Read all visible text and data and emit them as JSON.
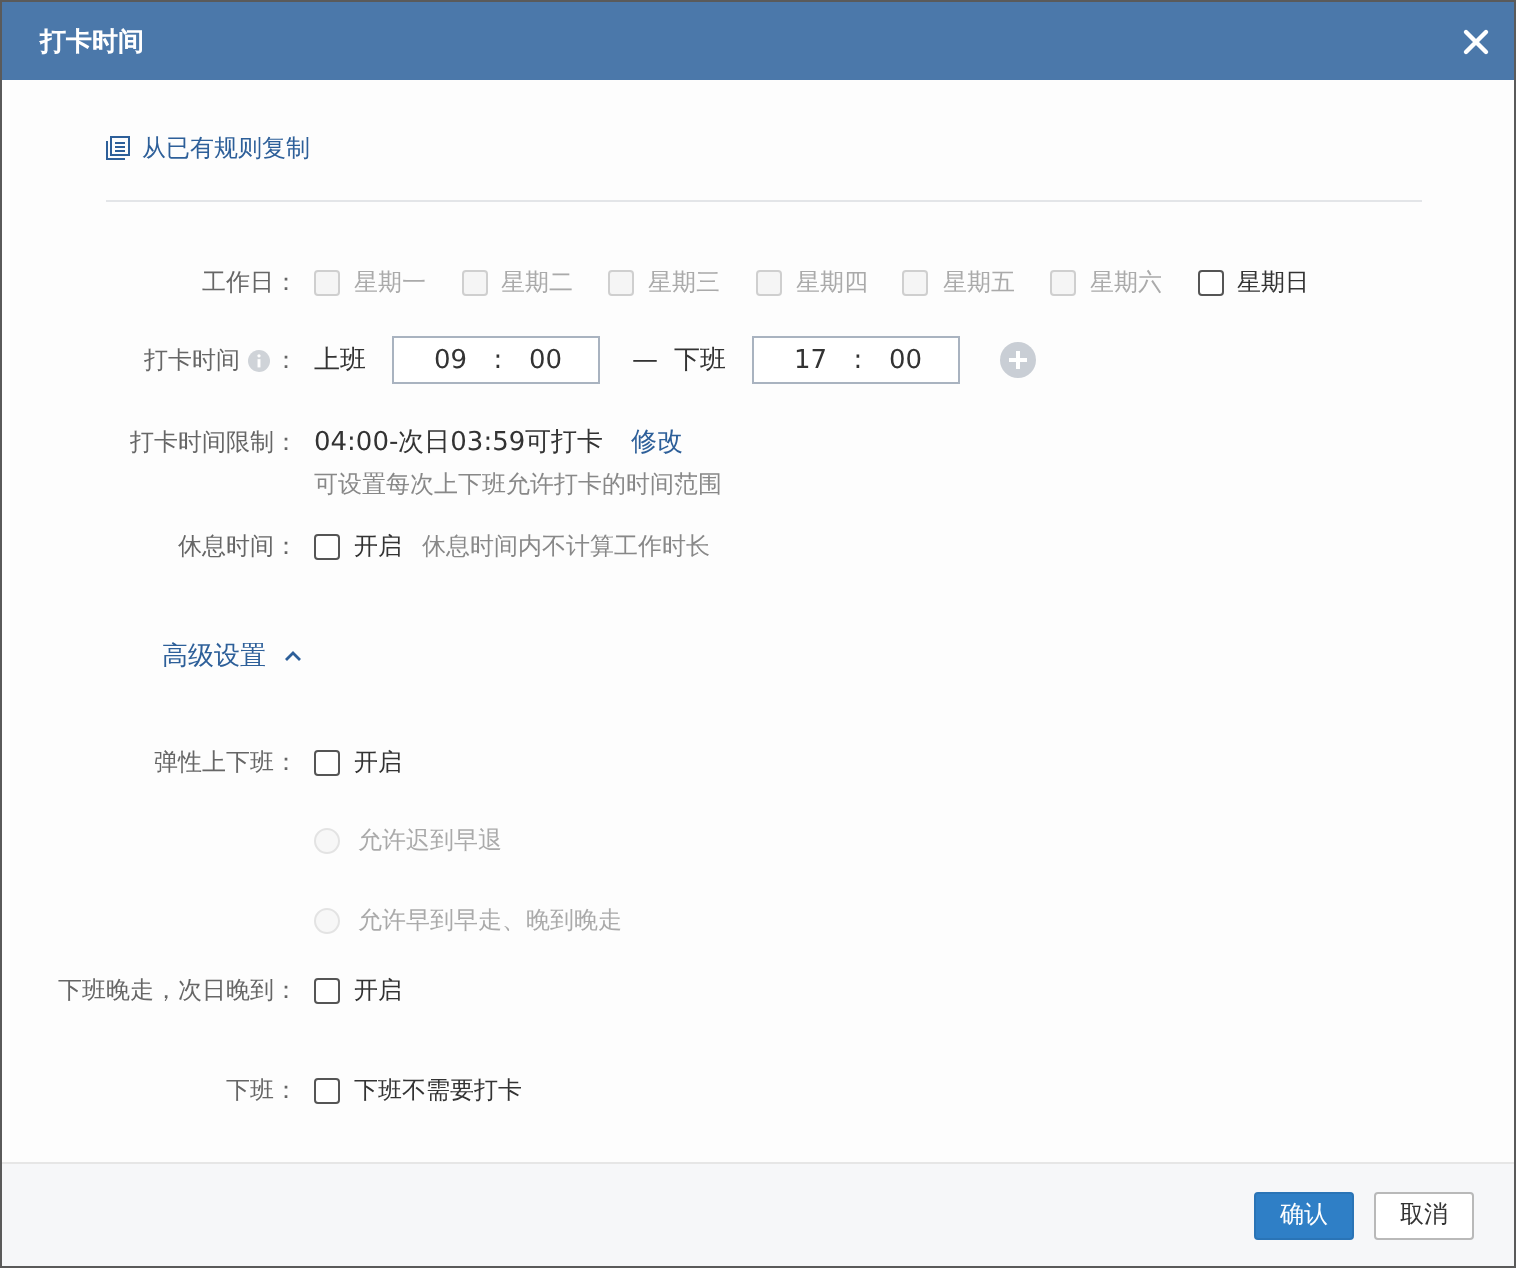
{
  "dialog": {
    "title": "打卡时间"
  },
  "copy_link": "从已有规则复制",
  "workdays": {
    "label": "工作日：",
    "days": [
      {
        "label": "星期一",
        "checked": false,
        "disabled": true
      },
      {
        "label": "星期二",
        "checked": false,
        "disabled": true
      },
      {
        "label": "星期三",
        "checked": false,
        "disabled": true
      },
      {
        "label": "星期四",
        "checked": false,
        "disabled": true
      },
      {
        "label": "星期五",
        "checked": false,
        "disabled": true
      },
      {
        "label": "星期六",
        "checked": false,
        "disabled": true
      },
      {
        "label": "星期日",
        "checked": false,
        "disabled": false
      }
    ]
  },
  "clock_time": {
    "label": "打卡时间",
    "colon": "：",
    "dash": "—",
    "shifts": [
      {
        "label": "上班",
        "hour": "09",
        "separator": ":",
        "minute": "00"
      },
      {
        "label": "下班",
        "hour": "17",
        "separator": ":",
        "minute": "00"
      }
    ]
  },
  "limit": {
    "label": "打卡时间限制：",
    "value": "04:00-次日03:59可打卡",
    "edit_link": "修改",
    "hint": "可设置每次上下班允许打卡的时间范围"
  },
  "rest": {
    "label": "休息时间：",
    "checked": false,
    "option": "开启",
    "hint": "休息时间内不计算工作时长"
  },
  "advanced": {
    "label": "高级设置",
    "expanded": true
  },
  "flexible": {
    "label": "弹性上下班：",
    "checked": false,
    "option": "开启",
    "modes": [
      {
        "label": "允许迟到早退",
        "selected": false,
        "disabled": true
      },
      {
        "label": "允许早到早走、晚到晚走",
        "selected": false,
        "disabled": true
      }
    ]
  },
  "late_next_day": {
    "label": "下班晚走，次日晚到：",
    "checked": false,
    "option": "开启"
  },
  "off_duty": {
    "label": "下班：",
    "checked": false,
    "option": "下班不需要打卡"
  },
  "buttons": [
    {
      "label": "确认",
      "kind": "primary"
    },
    {
      "label": "取消",
      "kind": "default"
    }
  ]
}
